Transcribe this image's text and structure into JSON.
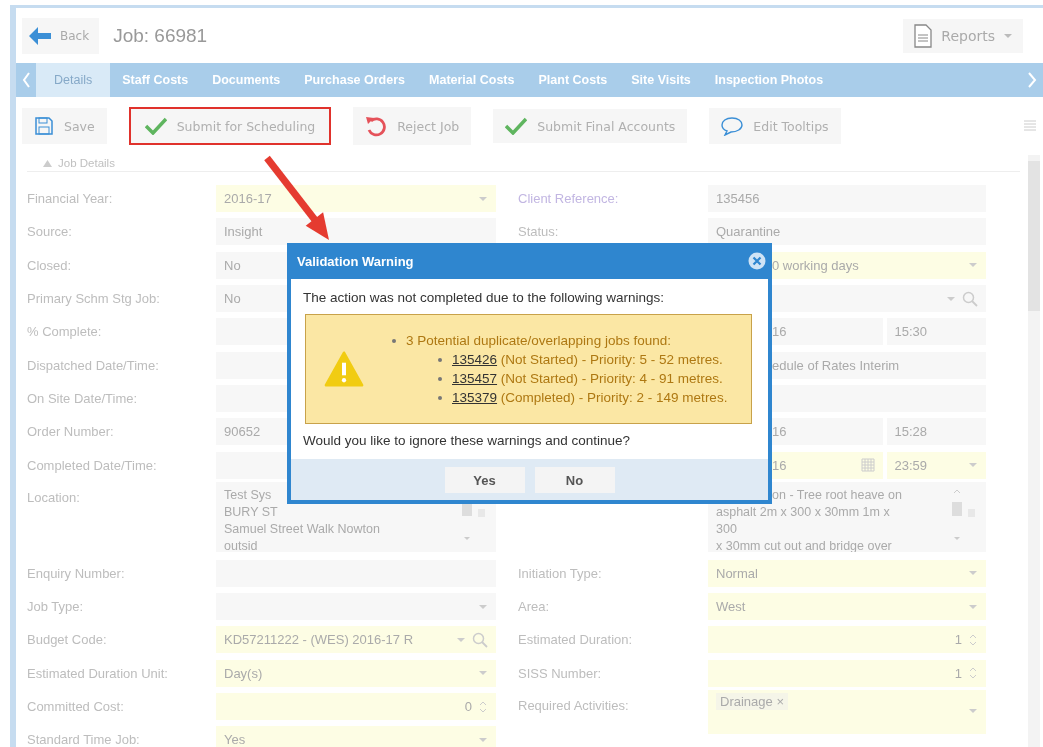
{
  "header": {
    "back": "Back",
    "title": "Job: 66981",
    "reports": "Reports"
  },
  "tabs": [
    {
      "label": "Details",
      "selected": true
    },
    {
      "label": "Staff Costs",
      "selected": false
    },
    {
      "label": "Documents",
      "selected": false
    },
    {
      "label": "Purchase Orders",
      "selected": false
    },
    {
      "label": "Material Costs",
      "selected": false
    },
    {
      "label": "Plant Costs",
      "selected": false
    },
    {
      "label": "Site Visits",
      "selected": false
    },
    {
      "label": "Inspection Photos",
      "selected": false
    }
  ],
  "toolbar": [
    {
      "label": "Save",
      "kind": "save",
      "highlighted": false
    },
    {
      "label": "Submit for Scheduling",
      "kind": "submit",
      "highlighted": true
    },
    {
      "label": "Reject Job",
      "kind": "reject",
      "highlighted": false
    },
    {
      "label": "Submit Final Accounts",
      "kind": "submit",
      "highlighted": false
    },
    {
      "label": "Edit Tooltips",
      "kind": "tooltip",
      "highlighted": false
    }
  ],
  "section": {
    "title": "Job Details",
    "expanded": true
  },
  "left_fields": [
    {
      "label": "Financial Year:",
      "kind": "select",
      "value": "2016-17",
      "required": true
    },
    {
      "label": "Source:",
      "kind": "text",
      "value": "Insight",
      "required": false
    },
    {
      "label": "Closed:",
      "kind": "text",
      "value": "No",
      "required": false
    },
    {
      "label": "Primary Schm Stg Job:",
      "kind": "text",
      "value": "No",
      "required": false
    },
    {
      "label": "% Complete:",
      "kind": "text",
      "required": false
    },
    {
      "label": "Dispatched Date/Time:",
      "kind": "text",
      "required": false
    },
    {
      "label": "On Site Date/Time:",
      "kind": "text",
      "required": false
    },
    {
      "label": "Order Number:",
      "kind": "text",
      "value": "90652",
      "required": false
    },
    {
      "label": "Completed Date/Time:",
      "kind": "text",
      "required": false
    },
    {
      "label": "Location:",
      "kind": "textarea",
      "lines": [
        "Test Sys",
        "BURY ST",
        "Samuel Street Walk Nowton",
        "outsid"
      ],
      "required": false
    },
    {
      "label": "Enquiry Number:",
      "kind": "text",
      "required": false
    },
    {
      "label": "Job Type:",
      "kind": "select",
      "required": false
    },
    {
      "label": "Budget Code:",
      "kind": "lookup",
      "value": "KD57211222 - (WES) 2016-17 R",
      "required": true
    },
    {
      "label": "Estimated Duration Unit:",
      "kind": "select",
      "value": "Day(s)",
      "required": true
    },
    {
      "label": "Committed Cost:",
      "kind": "spin",
      "value": "0",
      "required": true
    },
    {
      "label": "Standard Time Job:",
      "kind": "select",
      "value": "Yes",
      "required": true
    }
  ],
  "right_fields": [
    {
      "label": "Client Reference:",
      "kind": "text",
      "value": "135456",
      "required": false
    },
    {
      "label": "Status:",
      "kind": "text",
      "value": "Quarantine",
      "required": false
    },
    {
      "kind": "select",
      "value": "0 working days",
      "required": true,
      "covered": true
    },
    {
      "kind": "lookup",
      "required": false
    },
    {
      "kind": "datetime",
      "value": "16",
      "time": "15:30",
      "required": false,
      "covered": true
    },
    {
      "kind": "text",
      "value": "edule of Rates Interim",
      "required": false,
      "covered": true
    },
    {
      "kind": "text",
      "required": false
    },
    {
      "kind": "datetime",
      "value": "16",
      "time": "15:28",
      "required": false,
      "covered": true
    },
    {
      "kind": "datetime",
      "value": "16",
      "time": "23:59",
      "required": true,
      "covered": true
    },
    {
      "kind": "textarea",
      "lines": [
        "on - Tree root heave on",
        "asphalt 2m x 300 x 30mm  1m x",
        "300",
        "x 30mm cut out and bridge over"
      ],
      "required": false,
      "covered": true
    },
    {
      "label": "Initiation Type:",
      "kind": "select",
      "value": "Normal",
      "required": true
    },
    {
      "label": "Area:",
      "kind": "select",
      "value": "West",
      "required": true
    },
    {
      "label": "Estimated Duration:",
      "kind": "spin",
      "value": "1",
      "required": true
    },
    {
      "label": "SISS Number:",
      "kind": "spin",
      "value": "1",
      "required": true
    },
    {
      "label": "Required Activities:",
      "kind": "tags",
      "tags": [
        {
          "label": "Drainage",
          "remove": "×"
        }
      ],
      "required": true
    }
  ],
  "dialog": {
    "title": "Validation Warning",
    "message": "The action was not completed due to the following warnings:",
    "warning": "3 Potential duplicate/overlapping jobs found:",
    "jobs": [
      {
        "number": "135426",
        "detail": "(Not Started) - Priority: 5 - 52 metres."
      },
      {
        "number": "135457",
        "detail": "(Not Started) - Priority: 4 - 91 metres."
      },
      {
        "number": "135379",
        "detail": "(Completed) - Priority: 2 - 149 metres."
      }
    ],
    "question": "Would you like to ignore these warnings and continue?",
    "buttons": [
      "Yes",
      "No"
    ]
  }
}
